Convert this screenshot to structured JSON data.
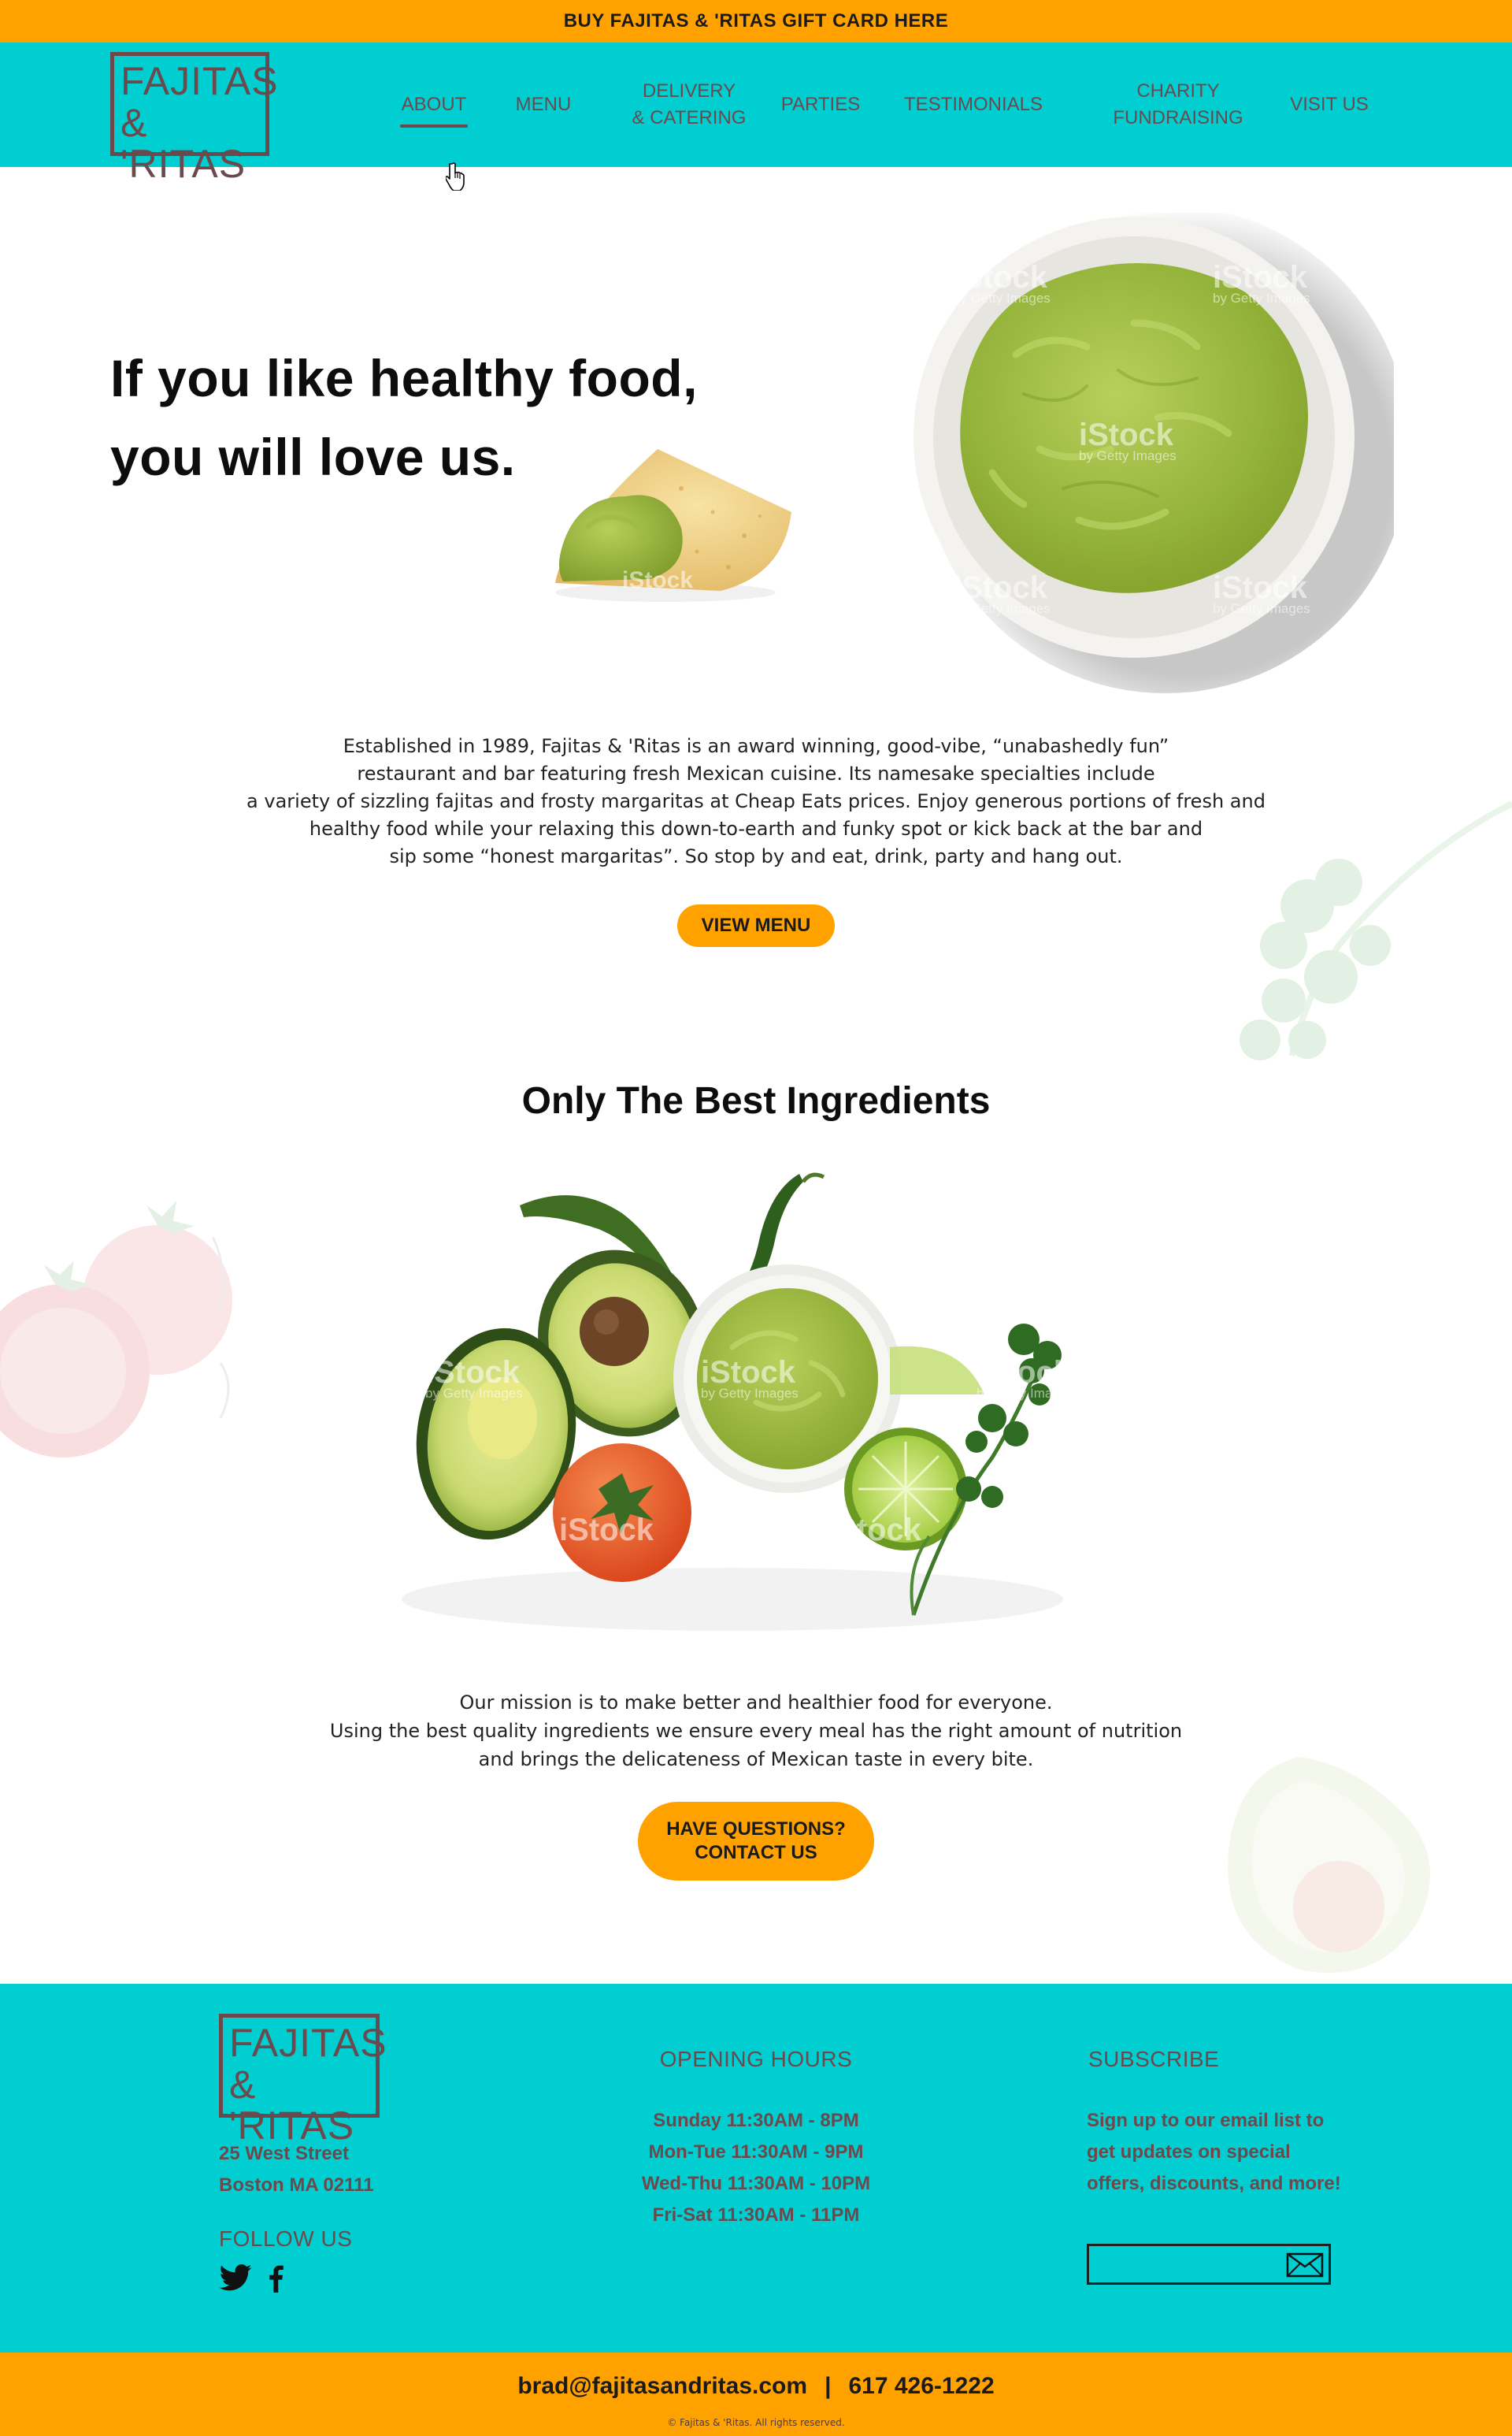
{
  "promo": {
    "text": "BUY FAJITAS & 'RITAS GIFT CARD HERE"
  },
  "brand": {
    "line1": "FAJITAS",
    "line2": "& 'RITAS"
  },
  "nav": {
    "items": [
      {
        "label": "ABOUT",
        "active": true
      },
      {
        "label": "MENU"
      },
      {
        "label_line1": "DELIVERY",
        "label_line2": "& CATERING"
      },
      {
        "label": "PARTIES"
      },
      {
        "label": "TESTIMONIALS"
      },
      {
        "label_line1": "CHARITY",
        "label_line2": "FUNDRAISING"
      },
      {
        "label": "VISIT US"
      }
    ]
  },
  "hero": {
    "title_line1": "If you like healthy food,",
    "title_line2": "you will love us."
  },
  "watermark": {
    "brand": "iStock",
    "sub": "by Getty Images"
  },
  "intro": {
    "lines": [
      "Established in 1989, Fajitas & 'Ritas is an award winning, good-vibe, “unabashedly fun”",
      "restaurant and bar featuring fresh Mexican cuisine. Its namesake specialties include",
      "a variety of sizzling fajitas and frosty margaritas at Cheap Eats prices. Enjoy generous portions of fresh and",
      "healthy food while your relaxing this down-to-earth and funky spot or kick back at the bar and",
      "sip some “honest margaritas”.  So stop by and eat, drink, party and hang out."
    ],
    "button": "VIEW MENU"
  },
  "ingredients": {
    "title": "Only The Best Ingredients",
    "mission_lines": [
      "Our mission is to make better and healthier food for everyone.",
      "Using the best quality ingredients we ensure every meal has the right amount of nutrition",
      "and brings the delicateness of Mexican taste in every bite."
    ],
    "button_line1": "HAVE QUESTIONS?",
    "button_line2": "CONTACT US"
  },
  "footer": {
    "address_line1": "25 West Street",
    "address_line2": "Boston MA 02111",
    "follow_title": "FOLLOW US",
    "social": [
      "twitter-icon",
      "facebook-icon"
    ],
    "hours_title": "OPENING HOURS",
    "hours": [
      "Sunday 11:30AM - 8PM",
      "Mon-Tue 11:30AM - 9PM",
      "Wed-Thu 11:30AM - 10PM",
      "Fri-Sat 11:30AM - 11PM"
    ],
    "subscribe_title": "SUBSCRIBE",
    "subscribe_text": "Sign up to our email list to get updates on special offers, discounts, and more!",
    "subscribe_placeholder": ""
  },
  "contact": {
    "email": "brad@fajitasandritas.com",
    "separator": "|",
    "phone": "617 426-1222",
    "copyright": "© Fajitas & 'Ritas. All rights reserved."
  },
  "colors": {
    "accent_orange": "#ffa200",
    "teal": "#00ced1",
    "brand_brown": "#6b4a4d"
  }
}
